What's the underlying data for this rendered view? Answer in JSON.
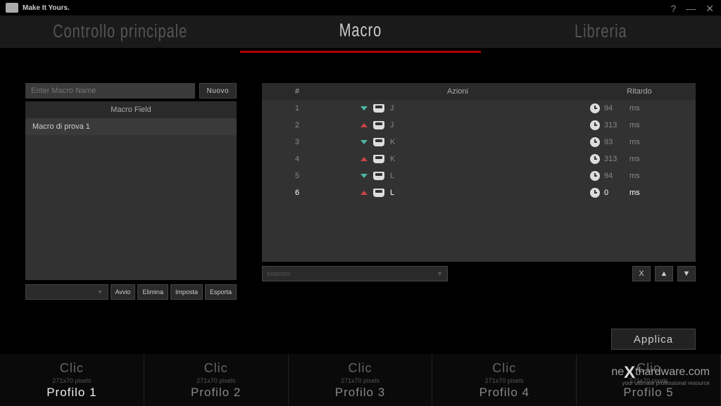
{
  "app": {
    "tagline": "Make It Yours."
  },
  "tabs": {
    "main": "Controllo principale",
    "macro": "Macro",
    "library": "Libreria"
  },
  "macroPanel": {
    "placeholder": "Enter Macro Name",
    "newBtn": "Nuovo",
    "fieldHeader": "Macro Field",
    "items": [
      "Macro di prova 1"
    ],
    "recordDropdown": "",
    "btns": {
      "start": "Avvio",
      "delete": "Elimina",
      "set": "Imposta",
      "export": "Esporta"
    }
  },
  "actionPanel": {
    "headers": {
      "num": "#",
      "action": "Azioni",
      "delay": "Ritardo"
    },
    "rows": [
      {
        "n": "1",
        "dir": "down",
        "key": "J",
        "delay": "94",
        "unit": "ms",
        "sel": false
      },
      {
        "n": "2",
        "dir": "up",
        "key": "J",
        "delay": "313",
        "unit": "ms",
        "sel": false
      },
      {
        "n": "3",
        "dir": "down",
        "key": "K",
        "delay": "93",
        "unit": "ms",
        "sel": false
      },
      {
        "n": "4",
        "dir": "up",
        "key": "K",
        "delay": "313",
        "unit": "ms",
        "sel": false
      },
      {
        "n": "5",
        "dir": "down",
        "key": "L",
        "delay": "94",
        "unit": "ms",
        "sel": false
      },
      {
        "n": "6",
        "dir": "up",
        "key": "L",
        "delay": "0",
        "unit": "ms",
        "sel": true
      }
    ],
    "insert": "Inserisci",
    "actions": {
      "del": "X",
      "up": "▲",
      "down": "▼"
    }
  },
  "applyBtn": "Applica",
  "profiles": {
    "clic": "Clic",
    "dim": "271x70 pixels",
    "items": [
      "Profilo 1",
      "Profilo 2",
      "Profilo 3",
      "Profilo 4",
      "Profilo 5"
    ],
    "active": 0
  },
  "watermark": {
    "pre": "ne",
    "x": "X",
    "post": "thardware",
    "tld": ".com",
    "sub": "your ultimate professional resource"
  }
}
